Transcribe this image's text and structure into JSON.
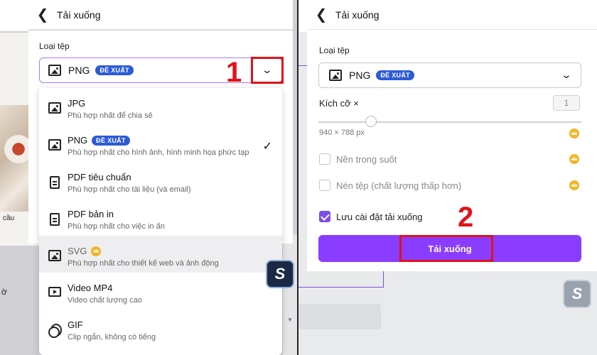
{
  "left": {
    "header": {
      "back": "❮",
      "title": "Tải xuống"
    },
    "file_type_label": "Loại tệp",
    "selected": {
      "name": "PNG",
      "badge": "ĐỀ XUẤT"
    },
    "step_number": "1",
    "background_text": [
      "cầu",
      "ờ"
    ],
    "options": [
      {
        "icon": "image-icon",
        "name": "JPG",
        "desc": "Phù hợp nhất để chia sẻ",
        "badge": "",
        "checked": false
      },
      {
        "icon": "image-icon",
        "name": "PNG",
        "desc": "Phù hợp nhất cho hình ảnh, hình minh họa phức tạp",
        "badge": "ĐỀ XUẤT",
        "checked": true
      },
      {
        "icon": "document-icon",
        "name": "PDF tiêu chuẩn",
        "desc": "Phù hợp nhất cho tài liệu (và email)",
        "badge": "",
        "checked": false
      },
      {
        "icon": "document-icon",
        "name": "PDF bản in",
        "desc": "Phù hợp nhất cho việc in ấn",
        "badge": "",
        "checked": false
      },
      {
        "icon": "image-icon",
        "name": "SVG",
        "desc": "Phù hợp nhất cho thiết kế web và ảnh động",
        "badge": "",
        "crown": true,
        "checked": false
      },
      {
        "icon": "video-icon",
        "name": "Video MP4",
        "desc": "Video chất lượng cao",
        "badge": "",
        "checked": false
      },
      {
        "icon": "gif-icon",
        "name": "GIF",
        "desc": "Clip ngắn, không có tiếng",
        "badge": "",
        "checked": false
      }
    ]
  },
  "right": {
    "header": {
      "back": "❮",
      "title": "Tải xuống"
    },
    "file_type_label": "Loại tệp",
    "selected": {
      "name": "PNG",
      "badge": "ĐỀ XUẤT"
    },
    "size_label": "Kích cỡ ×",
    "size_value": "1",
    "dimensions": "940 × 788 px",
    "transparent_bg": "Nền trong suốt",
    "compress_file": "Nén tệp (chất lượng thấp hơn)",
    "save_settings": "Lưu cài đặt tải xuống",
    "download_button": "Tải xuống",
    "step_number": "2"
  },
  "colors": {
    "accent": "#8b3dff",
    "badge": "#2c5bd6",
    "annotation": "#e0121b",
    "crown": "#f0b52b"
  }
}
